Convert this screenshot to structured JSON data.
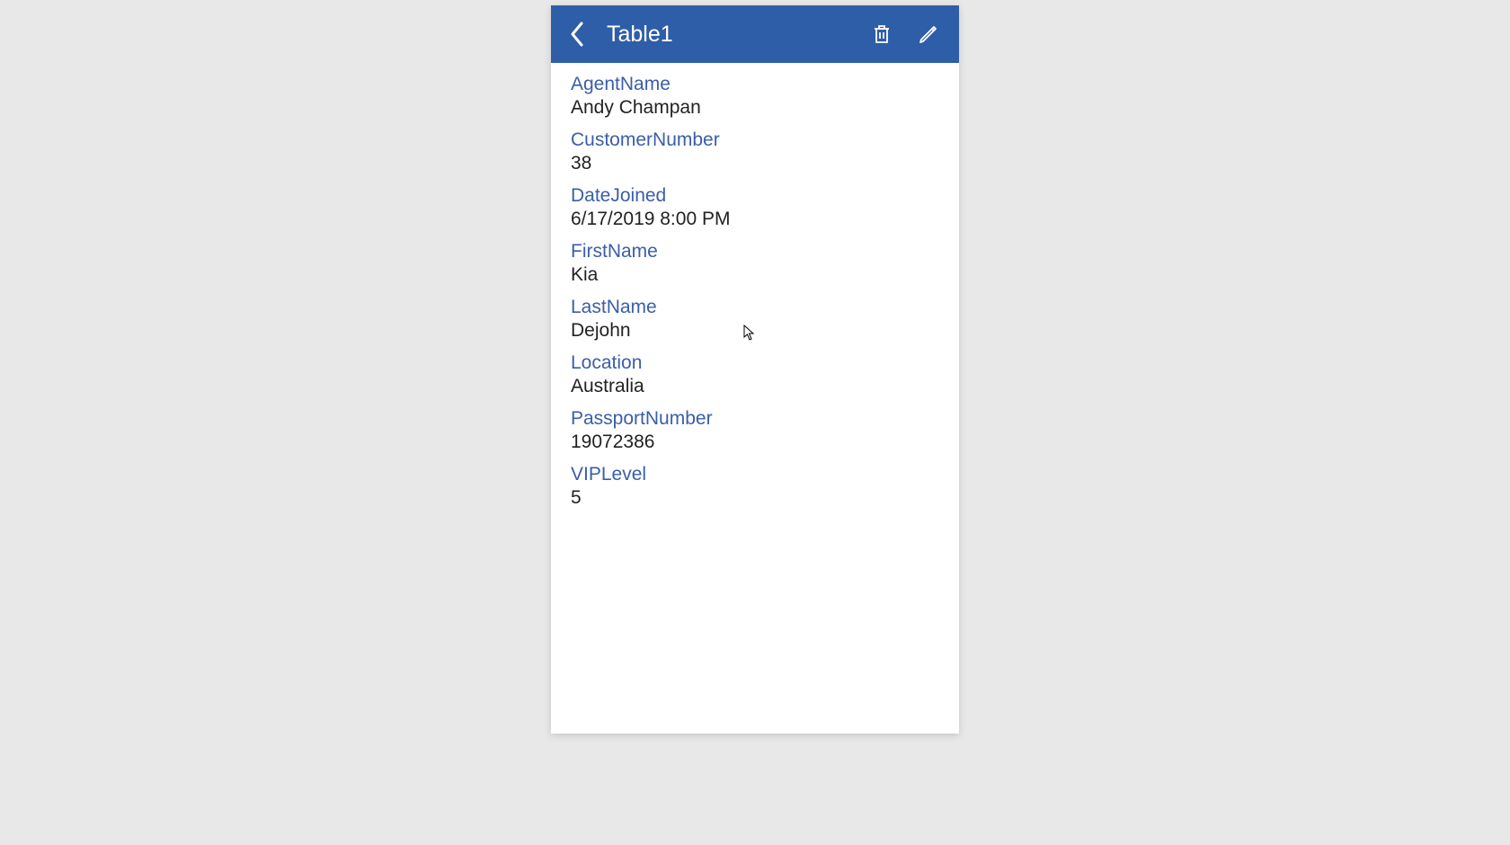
{
  "header": {
    "title": "Table1",
    "accent_color": "#2f5ea8"
  },
  "fields": [
    {
      "label": "AgentName",
      "value": "Andy Champan"
    },
    {
      "label": "CustomerNumber",
      "value": "38"
    },
    {
      "label": "DateJoined",
      "value": "6/17/2019 8:00 PM"
    },
    {
      "label": "FirstName",
      "value": "Kia"
    },
    {
      "label": "LastName",
      "value": "Dejohn"
    },
    {
      "label": "Location",
      "value": "Australia"
    },
    {
      "label": "PassportNumber",
      "value": "19072386"
    },
    {
      "label": "VIPLevel",
      "value": "5"
    }
  ]
}
